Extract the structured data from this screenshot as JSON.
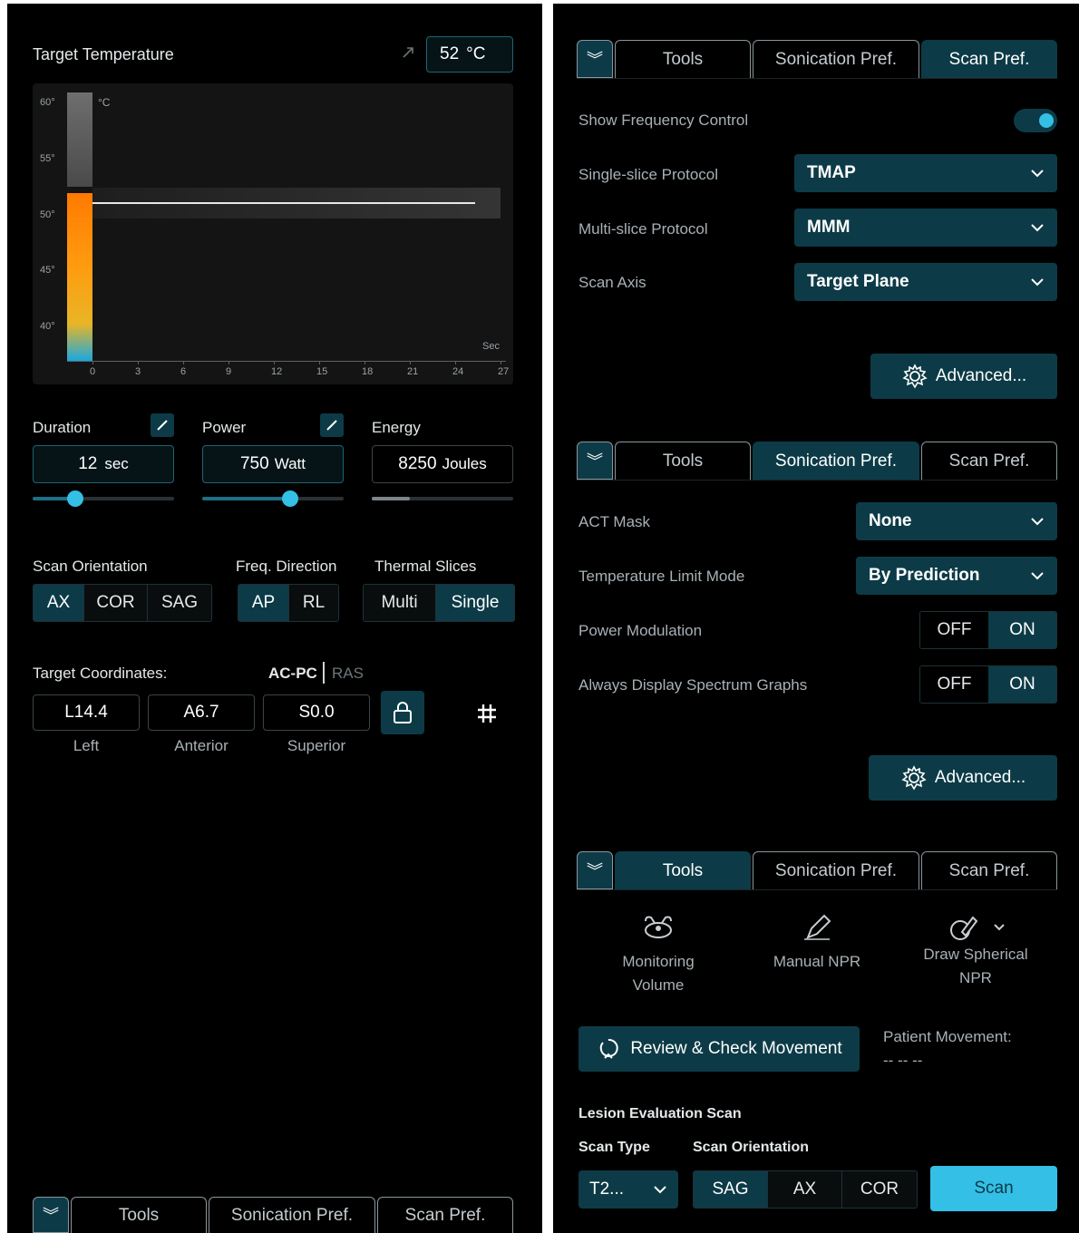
{
  "left": {
    "target_temp": {
      "title": "Target Temperature",
      "value": "52",
      "unit": "°C"
    },
    "chart_data": {
      "type": "bar",
      "title": "",
      "y_unit": "°C",
      "x_unit": "Sec",
      "y_ticks": [
        "60°",
        "55°",
        "50°",
        "45°",
        "40°"
      ],
      "x_ticks": [
        "0",
        "3",
        "6",
        "9",
        "12",
        "15",
        "18",
        "21",
        "24",
        "27"
      ],
      "ylim": [
        37,
        61
      ],
      "target_line": 52,
      "grid": false
    },
    "duration": {
      "label": "Duration",
      "value": "12",
      "unit": "sec",
      "slider_fraction": 0.3
    },
    "power": {
      "label": "Power",
      "value": "750",
      "unit": "Watt",
      "slider_fraction": 0.62
    },
    "energy": {
      "label": "Energy",
      "value": "8250",
      "unit": "Joules",
      "fill_fraction": 0.27
    },
    "scan_orientation": {
      "label": "Scan Orientation",
      "options": [
        "AX",
        "COR",
        "SAG"
      ],
      "selected": "AX"
    },
    "freq_direction": {
      "label": "Freq. Direction",
      "options": [
        "AP",
        "RL"
      ],
      "selected": "AP"
    },
    "thermal_slices": {
      "label": "Thermal Slices",
      "options": [
        "Multi",
        "Single"
      ],
      "selected": "Single"
    },
    "coords": {
      "label": "Target Coordinates:",
      "system_active": "AC-PC",
      "system_inactive": "RAS",
      "values": [
        "L14.4",
        "A6.7",
        "S0.0"
      ],
      "captions": [
        "Left",
        "Anterior",
        "Superior"
      ]
    },
    "tabs": {
      "tools": "Tools",
      "sonication": "Sonication Pref.",
      "scan": "Scan Pref."
    }
  },
  "right": {
    "scan_pref": {
      "tabs": {
        "tools": "Tools",
        "sonication": "Sonication Pref.",
        "scan": "Scan Pref."
      },
      "show_freq_label": "Show Frequency Control",
      "single_slice_label": "Single-slice Protocol",
      "single_slice_value": "TMAP",
      "multi_slice_label": "Multi-slice Protocol",
      "multi_slice_value": "MMM",
      "scan_axis_label": "Scan Axis",
      "scan_axis_value": "Target Plane",
      "advanced": "Advanced..."
    },
    "sonication_pref": {
      "tabs": {
        "tools": "Tools",
        "sonication": "Sonication Pref.",
        "scan": "Scan Pref."
      },
      "act_mask_label": "ACT Mask",
      "act_mask_value": "None",
      "temp_limit_label": "Temperature Limit Mode",
      "temp_limit_value": "By Prediction",
      "power_mod_label": "Power Modulation",
      "spectrum_label": "Always Display Spectrum Graphs",
      "off": "OFF",
      "on": "ON",
      "advanced": "Advanced..."
    },
    "tools": {
      "tabs": {
        "tools": "Tools",
        "sonication": "Sonication Pref.",
        "scan": "Scan Pref."
      },
      "monitoring_1": "Monitoring",
      "monitoring_2": "Volume",
      "manual_npr": "Manual NPR",
      "draw_spherical_1": "Draw Spherical",
      "draw_spherical_2": "NPR",
      "review_button": "Review & Check Movement",
      "patient_movement_label": "Patient Movement:",
      "patient_movement_value": "-- -- --",
      "lesion_title": "Lesion Evaluation Scan",
      "scan_type_label": "Scan Type",
      "scan_type_value": "T2...",
      "scan_orientation_label": "Scan Orientation",
      "orientation_options": [
        "SAG",
        "AX",
        "COR"
      ],
      "orientation_selected": "SAG",
      "scan_button": "Scan"
    }
  },
  "colors": {
    "accent": "#34bfe6",
    "panel": "#000000",
    "selected": "#0c3b47"
  }
}
